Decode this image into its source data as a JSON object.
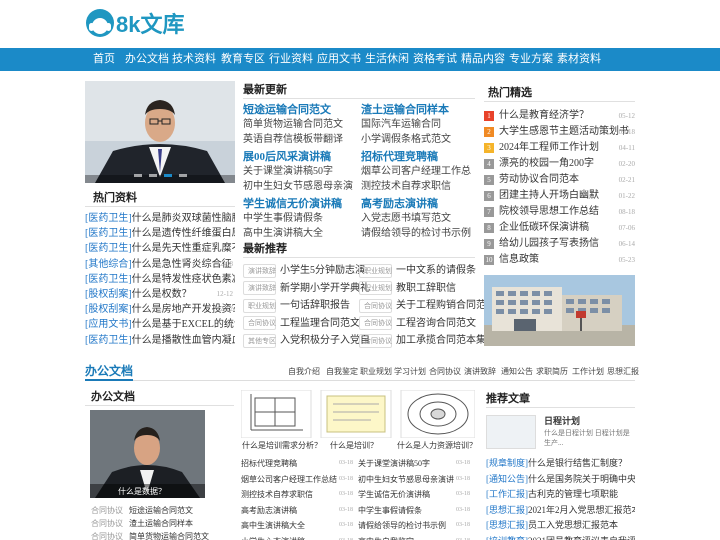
{
  "header": {
    "logo_text": "8k文库",
    "brand_color": "#1f97c1"
  },
  "nav": {
    "bg_color": "#1b8ac8",
    "items": [
      "首页",
      "办公文档",
      "技术资料",
      "教育专区",
      "行业资料",
      "应用文书",
      "生活休闲",
      "资格考试",
      "精品内容",
      "专业方案",
      "素材资料"
    ]
  },
  "slider": {
    "dots": 4,
    "active_dot": 2
  },
  "hot_docs": {
    "title": "热门资料",
    "items": [
      {
        "tag": "[医药卫生]",
        "title": "什么是肺炎双球菌性脑膜炎",
        "date": ""
      },
      {
        "tag": "[医药卫生]",
        "title": "什么是遗传性纤维蛋白原缺乏",
        "date": ""
      },
      {
        "tag": "[医药卫生]",
        "title": "什么是先天性重症乳糜不耐受",
        "date": ""
      },
      {
        "tag": "[其他综合]",
        "title": "什么是急性肾炎综合征",
        "date": "12-08"
      },
      {
        "tag": "[医药卫生]",
        "title": "什么是特发性痉状色素减少症",
        "date": ""
      },
      {
        "tag": "[股权刮案]",
        "title": "什么是权数？",
        "date": "12-12"
      },
      {
        "tag": "[股权刮案]",
        "title": "什么是房地产开发投资？",
        "date": "12-12"
      },
      {
        "tag": "[应用文书]",
        "title": "什么是基于EXCEL的统计应",
        "date": ""
      },
      {
        "tag": "[医药卫生]",
        "title": "什么是播散性血管内凝血(中医)",
        "date": ""
      }
    ]
  },
  "latest": {
    "title": "最新更新",
    "groups": [
      {
        "head": "短途运输合同范文",
        "lines": [
          "简单货物运输合同范文",
          "英语自荐信模板带翻译"
        ]
      },
      {
        "head": "渣土运输合同样本",
        "lines": [
          "国际汽车运输合同",
          "小学调假条格式范文"
        ]
      },
      {
        "head": "展00后风采演讲稿",
        "lines": [
          "关于课堂演讲稿50字",
          "初中生妇女节感恩母亲演"
        ]
      },
      {
        "head": "招标代理竞聘稿",
        "lines": [
          "烟草公司客户经理工作总",
          "测控技术自荐求职信"
        ]
      },
      {
        "head": "学生诚信无价演讲稿",
        "lines": [
          "中学生事假请假条",
          "高中生演讲稿大全"
        ]
      },
      {
        "head": "高考励志演讲稿",
        "lines": [
          "入党志愿书填写范文",
          "请假给领导的检讨书示例"
        ]
      }
    ]
  },
  "recommend": {
    "title": "最新推荐",
    "rows": [
      [
        {
          "tag": "演讲致辞",
          "text": "小学生5分钟励志演"
        },
        {
          "tag": "职业规划",
          "text": "一中文系的请假条"
        }
      ],
      [
        {
          "tag": "演讲致辞",
          "text": "新学期小学开学典礼"
        },
        {
          "tag": "职业规划",
          "text": "教职工辞职信"
        }
      ],
      [
        {
          "tag": "职业规划",
          "text": "一句话辞职报告"
        },
        {
          "tag": "合同协议",
          "text": "关于工程购销合同范"
        }
      ],
      [
        {
          "tag": "合同协议",
          "text": "工程监理合同范文"
        },
        {
          "tag": "合同协议",
          "text": "工程咨询合同范文"
        }
      ],
      [
        {
          "tag": "其他专区",
          "text": "入党积极分子入党自"
        },
        {
          "tag": "合同协议",
          "text": "加工承揽合同范本集"
        }
      ]
    ]
  },
  "picks": {
    "title": "热门精选",
    "items": [
      {
        "title": "什么是教育经济学？",
        "date": "05-12"
      },
      {
        "title": "大学生感恩节主题活动策划书",
        "date": "09-18"
      },
      {
        "title": "2024年工程师工作计划",
        "date": "04-11"
      },
      {
        "title": "漂亮的校园一角200字",
        "date": "02-20"
      },
      {
        "title": "劳动协议合同范本",
        "date": "02-21"
      },
      {
        "title": "团建主持人开场白幽默",
        "date": "01-22"
      },
      {
        "title": "院校领导思想工作总结",
        "date": "08-18"
      },
      {
        "title": "企业低碳环保演讲稿",
        "date": "07-06"
      },
      {
        "title": "给幼儿园孩子写表扬信",
        "date": "06-14"
      },
      {
        "title": "信息政策",
        "date": "05-23"
      }
    ],
    "num_colors": [
      "#e8422a",
      "#f08a24",
      "#f5b42a",
      "#999999",
      "#999999",
      "#999999",
      "#999999",
      "#999999",
      "#999999",
      "#999999"
    ]
  },
  "section2": {
    "title": "办公文档",
    "links": [
      "自我介绍",
      "自我鉴定",
      "职业规划",
      "学习计划",
      "合同协议",
      "演讲致辞",
      "通知公告",
      "求职简历",
      "工作计划",
      "思想汇报"
    ],
    "left_title": "办公文档",
    "left_caption": "什么是数据？",
    "left_items": [
      {
        "tag": "合同协议",
        "title": "短途运输合同范文"
      },
      {
        "tag": "合同协议",
        "title": "渣土运输合同样本"
      },
      {
        "tag": "合同协议",
        "title": "简单货物运输合同范文"
      }
    ],
    "thumbs": [
      "什么是培训需求分析？",
      "什么是培训？",
      "什么是人力资源培训？"
    ],
    "docs_left": [
      {
        "title": "招标代理竞聘稿",
        "date": "03-18"
      },
      {
        "title": "烟草公司客户经理工作总结",
        "date": "03-18"
      },
      {
        "title": "测控技术自荐求职信",
        "date": "03-18"
      },
      {
        "title": "高考励志演讲稿",
        "date": "03-18"
      },
      {
        "title": "高中生演讲稿大全",
        "date": "03-18"
      },
      {
        "title": "小学生心态演讲稿",
        "date": "03-18"
      }
    ],
    "docs_right": [
      {
        "title": "关于课堂演讲稿50字",
        "date": "03-18"
      },
      {
        "title": "初中生妇女节感恩母亲演讲",
        "date": "03-18"
      },
      {
        "title": "学生诚信无价演讲稿",
        "date": "03-18"
      },
      {
        "title": "中学生事假请假条",
        "date": "03-18"
      },
      {
        "title": "请假给领导的检讨书示例",
        "date": "03-18"
      },
      {
        "title": "高中生自我鉴定",
        "date": "03-18"
      }
    ],
    "rec_title": "推荐文章",
    "rec_feature_title": "日程计划",
    "rec_feature_desc": "什么是日程计划 日程计划是生产...",
    "rec_items": [
      {
        "tag": "[规章制度]",
        "title": "什么是银行结售汇制度？"
      },
      {
        "tag": "[通知公告]",
        "title": "什么是国务院关于明确中央与地"
      },
      {
        "tag": "[工作汇报]",
        "title": "古利克的管理七项职能"
      },
      {
        "tag": "[思想汇报]",
        "title": "2021年2月入党思想汇报范本"
      },
      {
        "tag": "[思想汇报]",
        "title": "员工入党思想汇报范本"
      },
      {
        "tag": "[培训教育]",
        "title": "2021团员教育评议表自我评价"
      }
    ]
  }
}
